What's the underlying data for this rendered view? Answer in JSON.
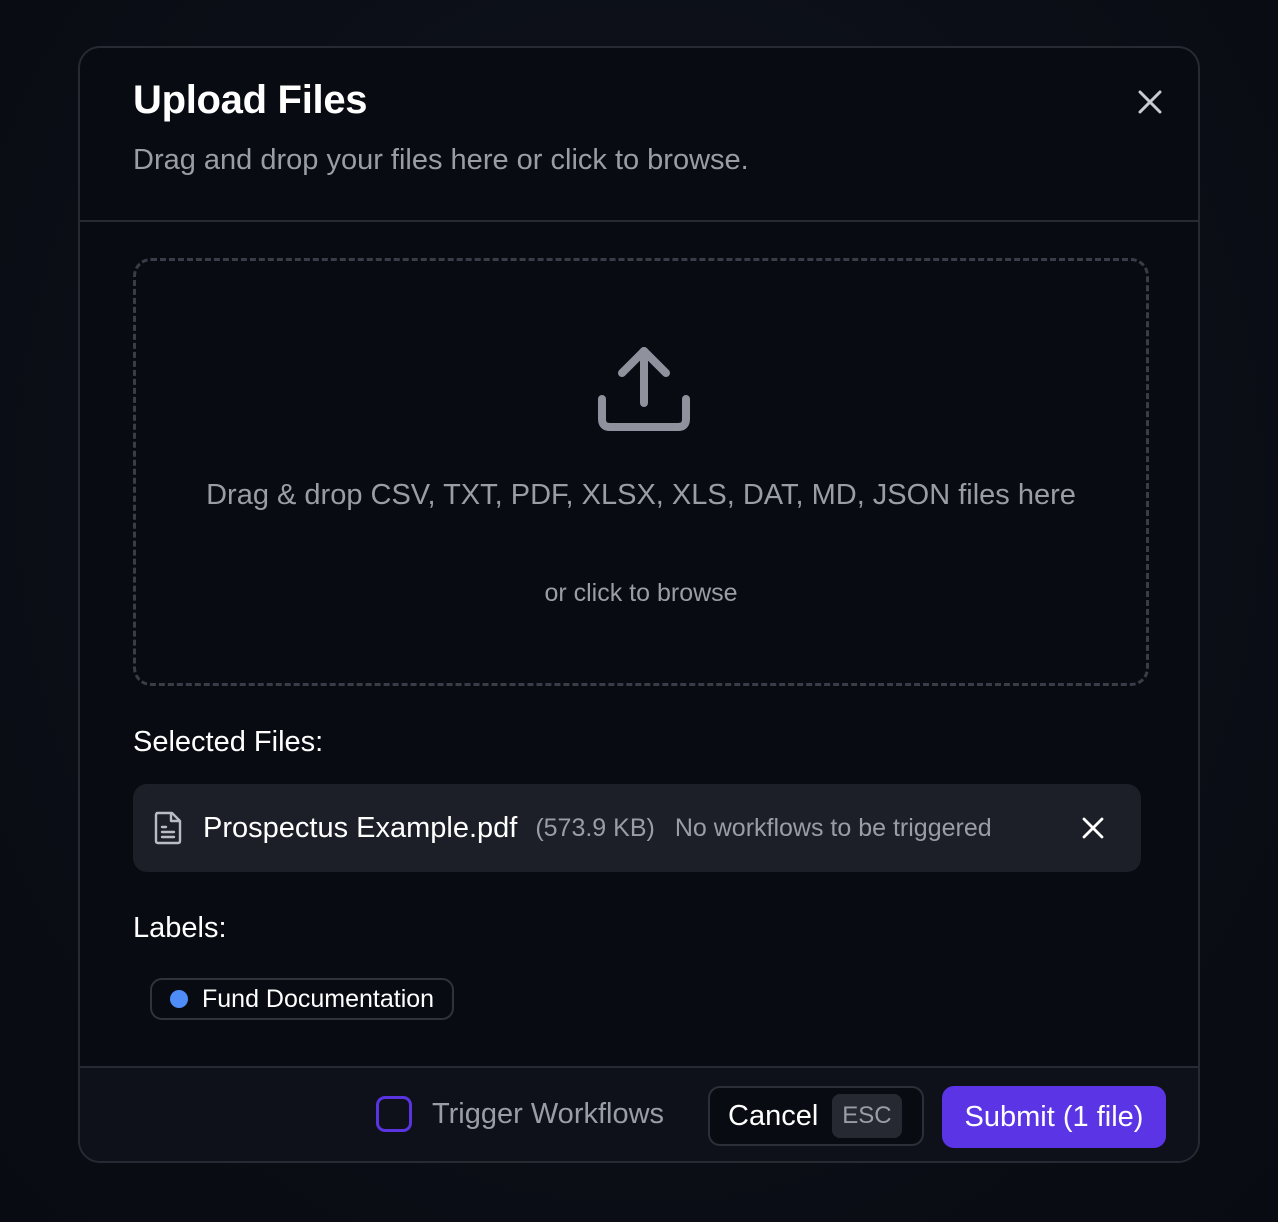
{
  "dialog": {
    "title": "Upload Files",
    "subtitle": "Drag and drop your files here or click to browse.",
    "close_icon": "close-icon"
  },
  "dropzone": {
    "icon": "upload-icon",
    "main_text": "Drag & drop CSV, TXT, PDF, XLSX, XLS, DAT, MD, JSON files here",
    "sub_text": "or click to browse"
  },
  "selected_files": {
    "heading": "Selected Files:",
    "items": [
      {
        "icon": "file-text-icon",
        "name": "Prospectus Example.pdf",
        "size": "(573.9 KB)",
        "status": "No workflows to be triggered",
        "remove_icon": "close-icon"
      }
    ]
  },
  "labels": {
    "heading": "Labels:",
    "items": [
      {
        "text": "Fund Documentation",
        "color": "#4e8cf7"
      }
    ]
  },
  "footer": {
    "trigger_label": "Trigger Workflows",
    "trigger_checked": false,
    "cancel_label": "Cancel",
    "cancel_shortcut": "ESC",
    "submit_label": "Submit (1 file)"
  },
  "colors": {
    "accent": "#5b34e6",
    "surface": "#1c1f28",
    "muted_text": "#9a9ca6",
    "border": "#272a33"
  }
}
